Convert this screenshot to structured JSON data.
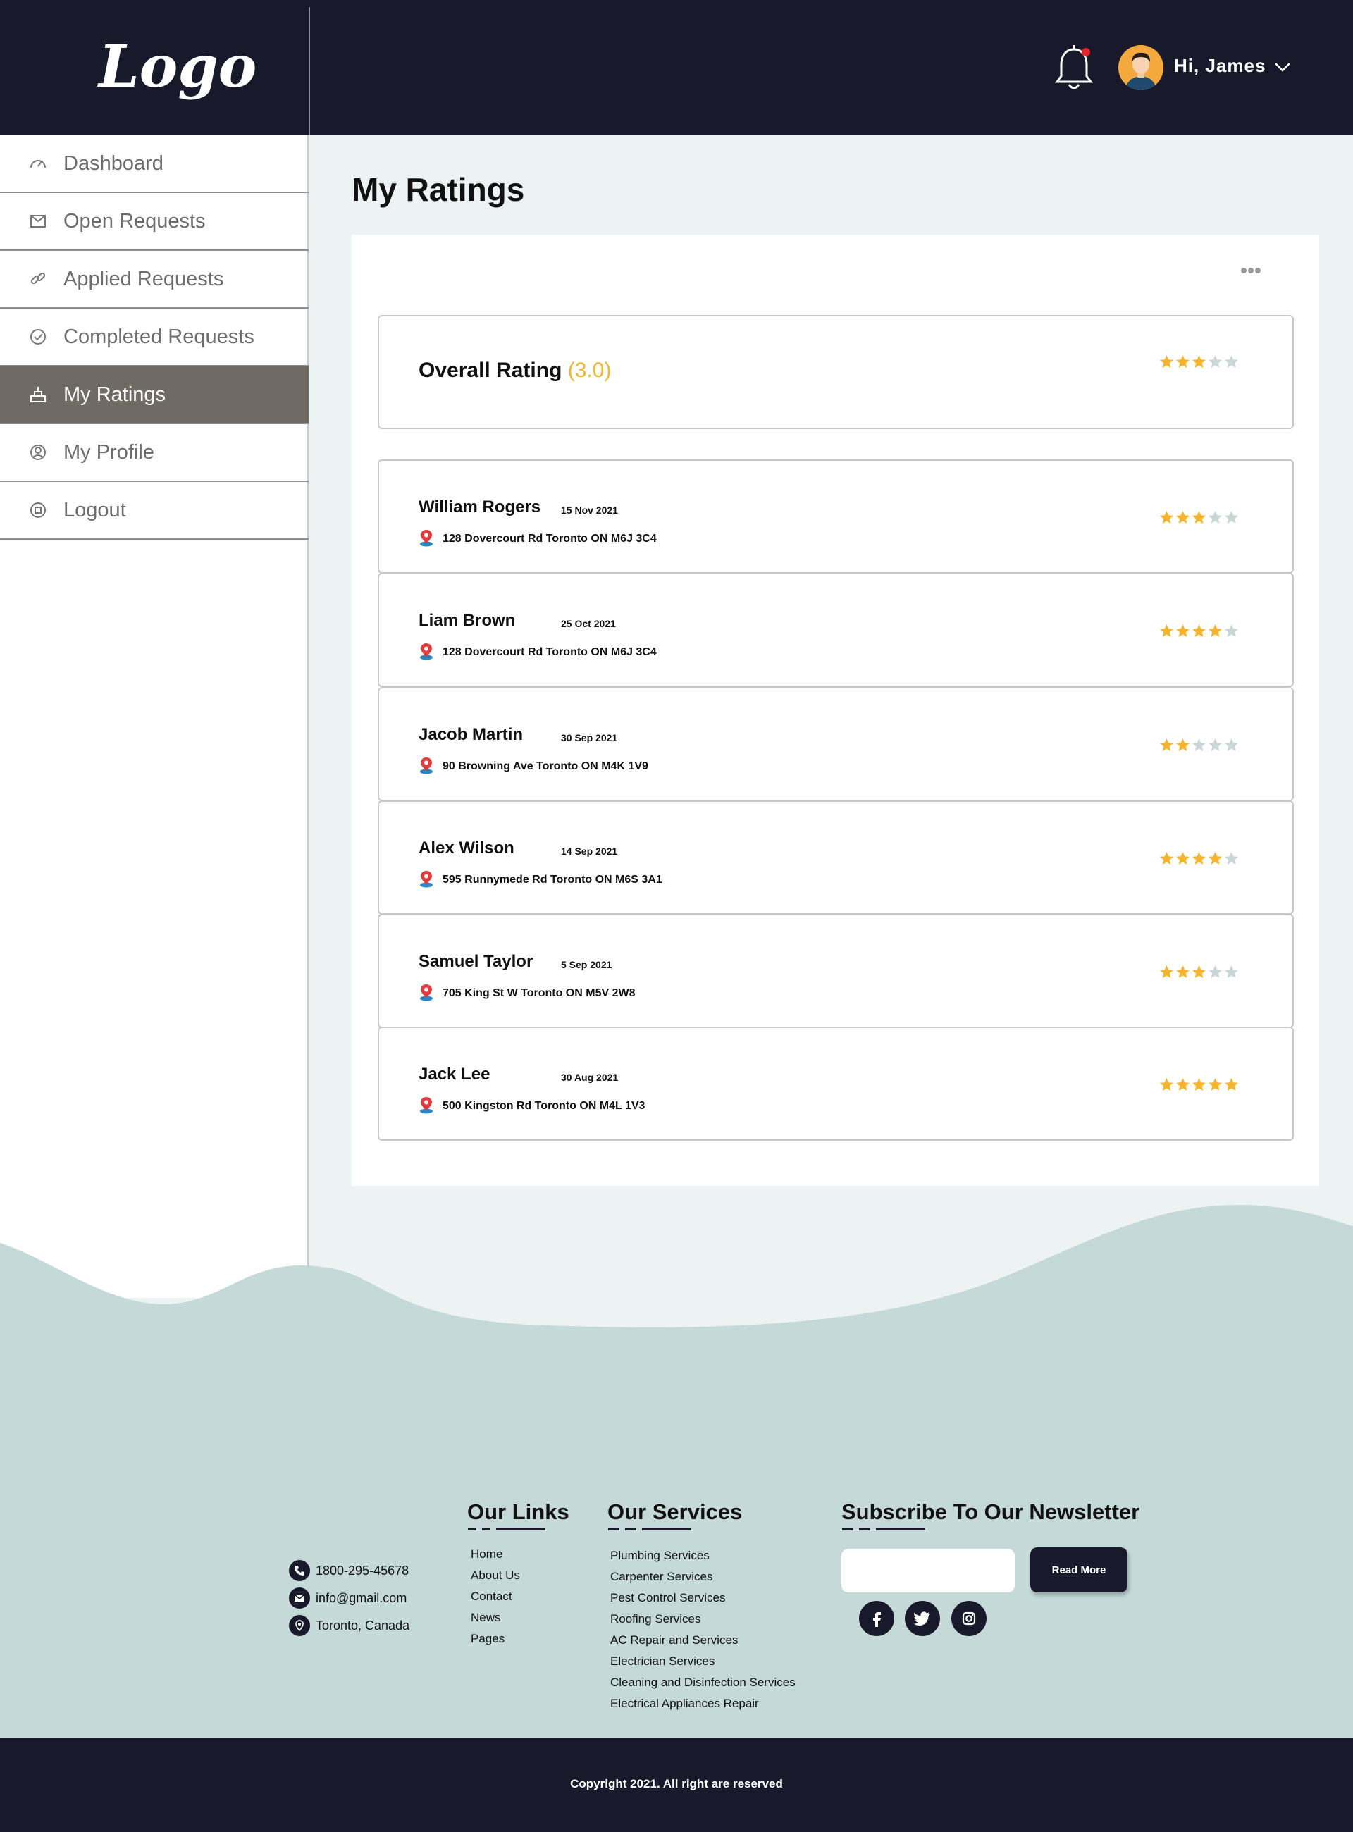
{
  "header": {
    "logo": "Logo",
    "greeting": "Hi, James"
  },
  "sidebar": {
    "items": [
      {
        "label": "Dashboard",
        "icon": "speedometer-icon"
      },
      {
        "label": "Open Requests",
        "icon": "open-request-icon"
      },
      {
        "label": "Applied Requests",
        "icon": "link-icon"
      },
      {
        "label": "Completed Requests",
        "icon": "check-circle-icon"
      },
      {
        "label": "My Ratings",
        "icon": "ratings-icon",
        "active": true
      },
      {
        "label": "My Profile",
        "icon": "profile-icon"
      },
      {
        "label": "Logout",
        "icon": "logout-icon"
      }
    ]
  },
  "main": {
    "title": "My Ratings",
    "overall": {
      "label": "Overall Rating",
      "value": "(3.0)",
      "stars": 3
    },
    "reviews": [
      {
        "name": "William Rogers",
        "date": "15 Nov 2021",
        "address": "128 Dovercourt Rd Toronto ON M6J 3C4",
        "stars": 3
      },
      {
        "name": "Liam Brown",
        "date": "25 Oct 2021",
        "address": "128 Dovercourt Rd Toronto ON M6J 3C4",
        "stars": 4
      },
      {
        "name": "Jacob Martin",
        "date": "30 Sep 2021",
        "address": "90 Browning Ave Toronto ON M4K 1V9",
        "stars": 2
      },
      {
        "name": "Alex Wilson",
        "date": "14 Sep 2021",
        "address": "595 Runnymede Rd Toronto ON M6S 3A1",
        "stars": 4
      },
      {
        "name": "Samuel Taylor",
        "date": "5 Sep 2021",
        "address": "705 King St W Toronto ON M5V 2W8",
        "stars": 3
      },
      {
        "name": "Jack Lee",
        "date": "30 Aug 2021",
        "address": "500 Kingston Rd Toronto ON M4L 1V3",
        "stars": 5
      }
    ]
  },
  "footer": {
    "contact": {
      "phone": "1800-295-45678",
      "email": "info@gmail.com",
      "location": "Toronto, Canada"
    },
    "links": {
      "heading": "Our Links",
      "items": [
        "Home",
        "About Us",
        "Contact",
        "News",
        "Pages"
      ]
    },
    "services": {
      "heading": "Our Services",
      "items": [
        "Plumbing Services",
        "Carpenter Services",
        "Pest Control Services",
        "Roofing Services",
        "AC Repair and Services",
        "Electrician Services",
        "Cleaning and Disinfection Services",
        "Electrical Appliances Repair"
      ]
    },
    "newsletter": {
      "heading": "Subscribe To Our Newsletter",
      "button": "Read More"
    },
    "social": [
      "facebook-icon",
      "twitter-icon",
      "instagram-icon"
    ],
    "copyright": "Copyright 2021. All right are reserved"
  },
  "colors": {
    "dark": "#181a2c",
    "accent_star": "#f6b42c",
    "star_empty": "#c9d6d8",
    "active_nav": "#6f6a64",
    "footer_bg": "#c4d9d8",
    "pin": "#e23b3b"
  }
}
